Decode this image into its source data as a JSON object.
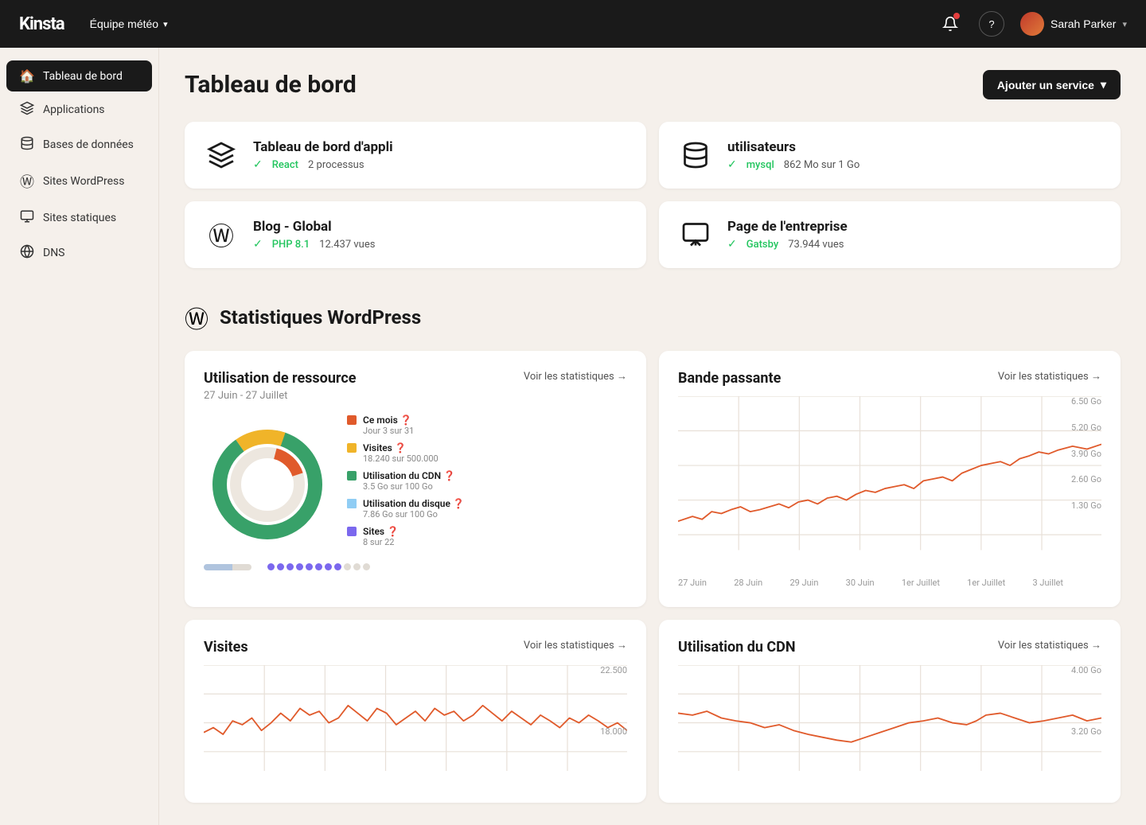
{
  "topnav": {
    "logo": "Kinsta",
    "team": "Équipe météo",
    "user": "Sarah Parker",
    "help_label": "?"
  },
  "sidebar": {
    "items": [
      {
        "id": "tableau-de-bord",
        "label": "Tableau de bord",
        "icon": "🏠",
        "active": true
      },
      {
        "id": "applications",
        "label": "Applications",
        "icon": "📦",
        "active": false
      },
      {
        "id": "bases-de-donnees",
        "label": "Bases de données",
        "icon": "🗄️",
        "active": false
      },
      {
        "id": "sites-wordpress",
        "label": "Sites WordPress",
        "icon": "Ⓦ",
        "active": false
      },
      {
        "id": "sites-statiques",
        "label": "Sites statiques",
        "icon": "🖥",
        "active": false
      },
      {
        "id": "dns",
        "label": "DNS",
        "icon": "🌐",
        "active": false
      }
    ]
  },
  "page": {
    "title": "Tableau de bord",
    "add_service_label": "Ajouter un service"
  },
  "services": [
    {
      "name": "Tableau de bord d'appli",
      "icon": "layers",
      "status": "React",
      "detail": "2 processus"
    },
    {
      "name": "utilisateurs",
      "icon": "db",
      "status": "mysql",
      "detail": "862 Mo sur 1 Go"
    },
    {
      "name": "Blog - Global",
      "icon": "wp",
      "status": "PHP 8.1",
      "detail": "12.437 vues"
    },
    {
      "name": "Page de l'entreprise",
      "icon": "static",
      "status": "Gatsby",
      "detail": "73.944 vues"
    }
  ],
  "wp_stats": {
    "title": "Statistiques WordPress"
  },
  "resource_chart": {
    "title": "Utilisation de ressource",
    "link": "Voir les statistiques →",
    "subtitle": "27 Juin - 27 Juillet",
    "legend": [
      {
        "color": "#e05a2b",
        "label": "Ce mois",
        "sub": "Jour 3 sur 31"
      },
      {
        "color": "#f0b429",
        "label": "Visites",
        "sub": "18.240 sur 500.000"
      },
      {
        "color": "#38a169",
        "label": "Utilisation du CDN",
        "sub": "3.5 Go sur 100 Go"
      },
      {
        "color": "#90cdf4",
        "label": "Utilisation du disque",
        "sub": "7.86 Go sur 100 Go"
      },
      {
        "color": "#7b68ee",
        "label": "Sites",
        "sub": "8 sur 22"
      }
    ]
  },
  "bandwidth_chart": {
    "title": "Bande passante",
    "link": "Voir les statistiques →",
    "x_labels": [
      "27 Juin",
      "28 Juin",
      "29 Juin",
      "30 Juin",
      "1er Juillet",
      "1er Juillet",
      "3 Juillet"
    ],
    "y_labels": [
      "6.50 Go",
      "5.20 Go",
      "3.90 Go",
      "2.60 Go",
      "1.30 Go"
    ]
  },
  "visits_chart": {
    "title": "Visites",
    "link": "Voir les statistiques →",
    "y_labels": [
      "22.500",
      "18.000"
    ]
  },
  "cdn_chart": {
    "title": "Utilisation du CDN",
    "link": "Voir les statistiques →",
    "y_labels": [
      "4.00 Go",
      "3.20 Go"
    ]
  }
}
